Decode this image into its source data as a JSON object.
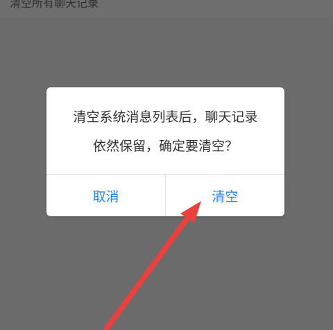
{
  "background_screen": {
    "partial_title": "清空所有聊天记录"
  },
  "dialog": {
    "message_line1": "清空系统消息列表后，聊天记录",
    "message_line2": "依然保留，确定要清空？",
    "cancel_label": "取消",
    "confirm_label": "清空"
  },
  "colors": {
    "overlay": "#6b6b6b",
    "dialog_bg": "#ffffff",
    "button_text": "#2a86d8",
    "annotation_arrow": "#e8413e"
  },
  "annotation": {
    "type": "arrow",
    "points_to": "confirm-button"
  }
}
